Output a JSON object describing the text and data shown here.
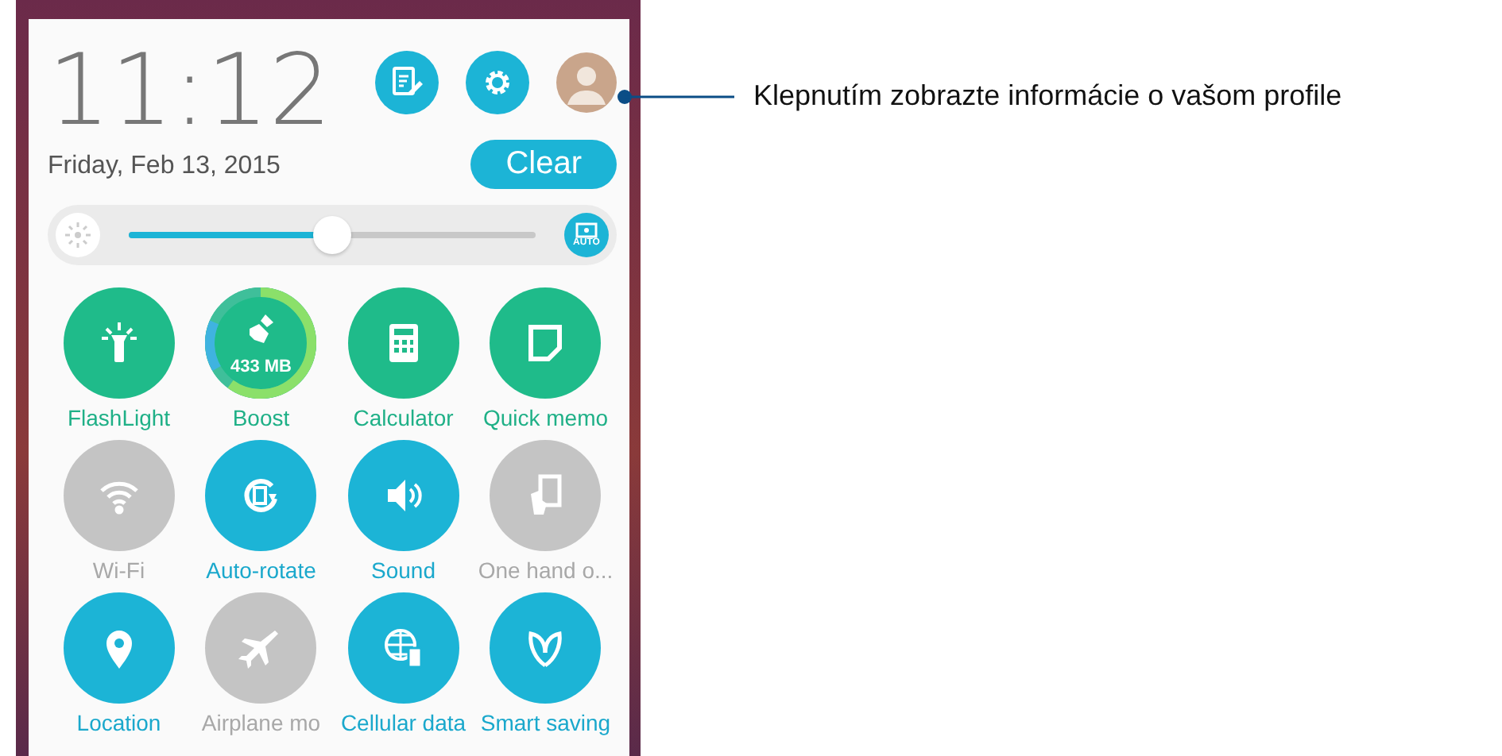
{
  "clock": {
    "time": "11:12",
    "date": "Friday, Feb 13, 2015"
  },
  "clear_button": "Clear",
  "brightness": {
    "level": 0.5,
    "auto_label": "AUTO"
  },
  "tiles": [
    {
      "label": "FlashLight",
      "kind": "shortcut"
    },
    {
      "label": "Boost",
      "kind": "boost",
      "reading": "433 MB"
    },
    {
      "label": "Calculator",
      "kind": "shortcut"
    },
    {
      "label": "Quick memo",
      "kind": "shortcut"
    },
    {
      "label": "Wi-Fi",
      "kind": "toggle",
      "on": false
    },
    {
      "label": "Auto-rotate",
      "kind": "toggle",
      "on": true
    },
    {
      "label": "Sound",
      "kind": "toggle",
      "on": true
    },
    {
      "label": "One hand o...",
      "kind": "toggle",
      "on": false
    },
    {
      "label": "Location",
      "kind": "toggle",
      "on": true
    },
    {
      "label": "Airplane mo",
      "kind": "toggle",
      "on": false
    },
    {
      "label": "Cellular data",
      "kind": "toggle",
      "on": true
    },
    {
      "label": "Smart saving",
      "kind": "toggle",
      "on": true
    }
  ],
  "callout": "Klepnutím zobrazte informácie o vašom profile"
}
